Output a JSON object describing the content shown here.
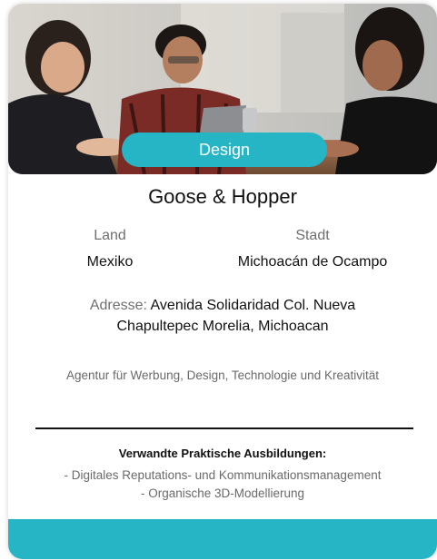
{
  "colors": {
    "accent": "#26b5c4"
  },
  "card": {
    "category": "Design",
    "company": "Goose & Hopper",
    "country_label": "Land",
    "country": "Mexiko",
    "city_label": "Stadt",
    "city": "Michoacán de Ocampo",
    "address_label": "Adresse:",
    "address": " Avenida Solidaridad Col. Nueva Chapultepec Morelia, Michoacan",
    "description": "Agentur für Werbung, Design, Technologie und Kreativität",
    "related_title": "Verwandte Praktische Ausbildungen:",
    "related": [
      "- Digitales Reputations- und Kommunikationsmanagement",
      "- Organische 3D-Modellierung"
    ]
  }
}
